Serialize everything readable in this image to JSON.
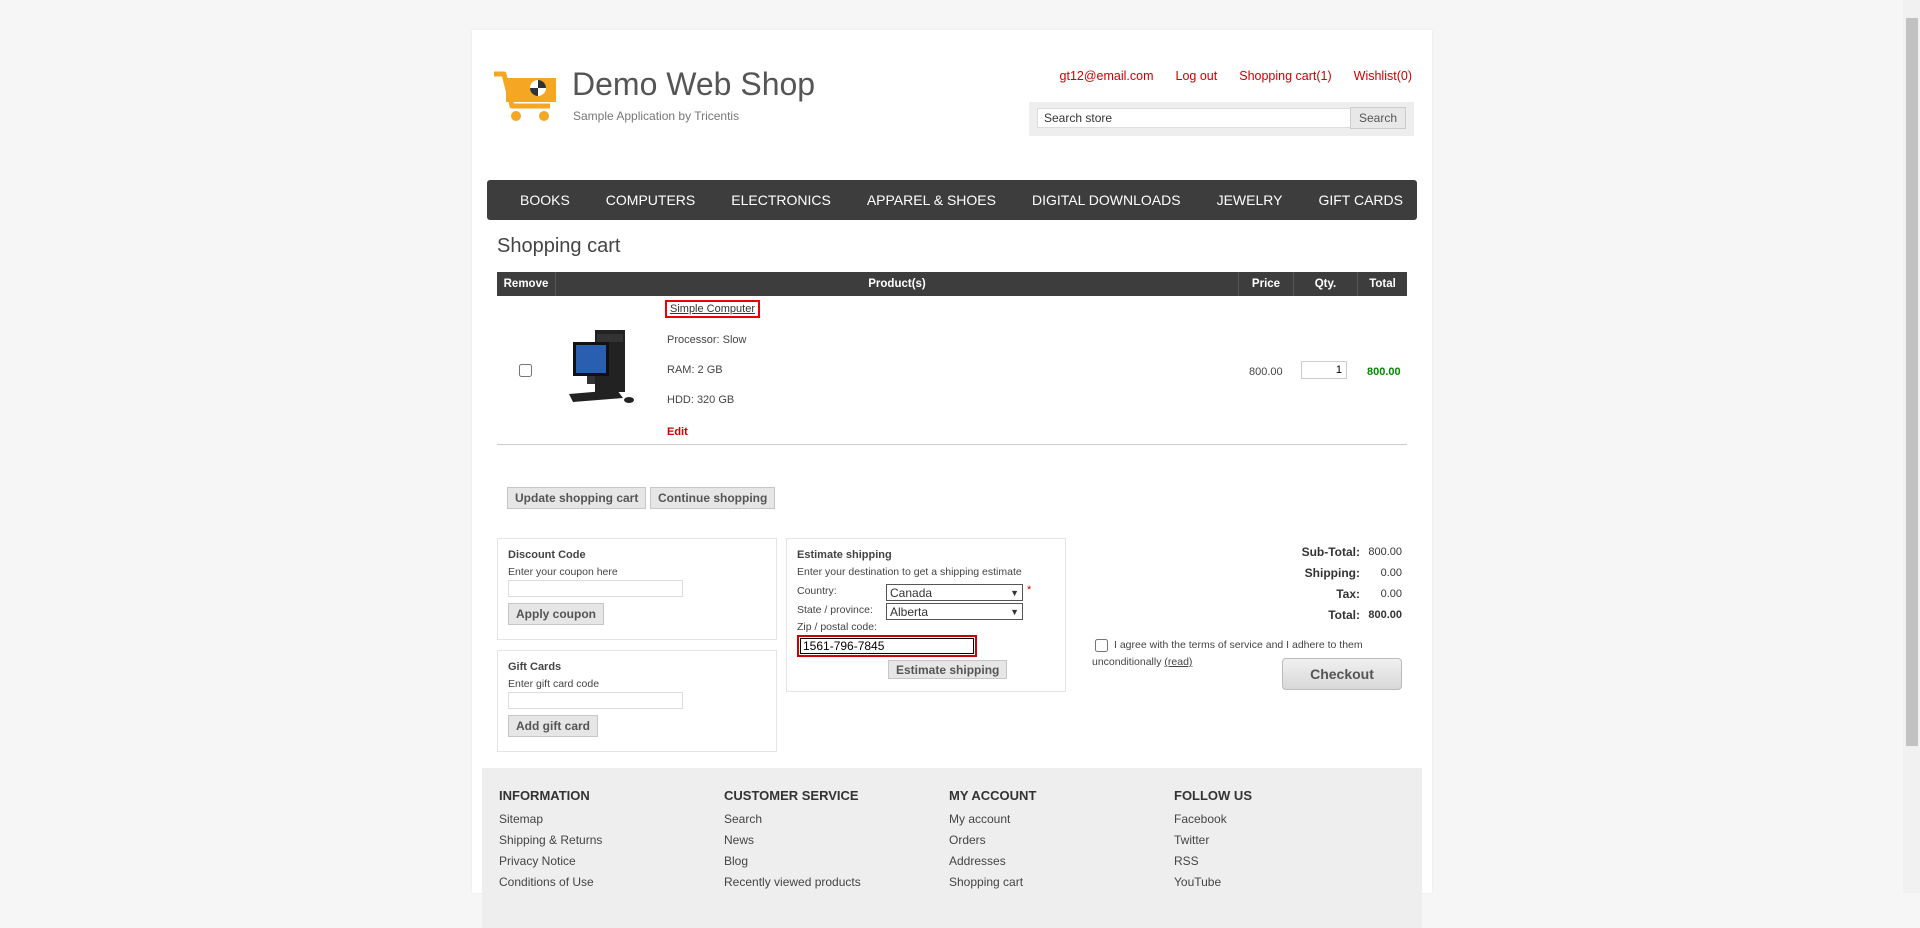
{
  "header": {
    "title": "Demo Web Shop",
    "subtitle": "Sample Application by Tricentis",
    "links": [
      "gt12@email.com",
      "Log out",
      "Shopping cart(1)",
      "Wishlist(0)"
    ],
    "search_placeholder": "Search store",
    "search_button": "Search"
  },
  "nav": [
    "BOOKS",
    "COMPUTERS",
    "ELECTRONICS",
    "APPAREL & SHOES",
    "DIGITAL DOWNLOADS",
    "JEWELRY",
    "GIFT CARDS"
  ],
  "cart": {
    "title": "Shopping cart",
    "columns": [
      "Remove",
      "Product(s)",
      "Price",
      "Qty.",
      "Total"
    ],
    "item": {
      "name": "Simple Computer",
      "attributes": [
        "Processor: Slow",
        "RAM: 2 GB",
        "HDD: 320 GB"
      ],
      "edit": "Edit",
      "price": "800.00",
      "qty": "1",
      "total": "800.00"
    },
    "update_button": "Update shopping cart",
    "continue_button": "Continue shopping"
  },
  "discount": {
    "title": "Discount Code",
    "text": "Enter your coupon here",
    "button": "Apply coupon"
  },
  "giftcards": {
    "title": "Gift Cards",
    "text": "Enter gift card code",
    "button": "Add gift card"
  },
  "shipping": {
    "title": "Estimate shipping",
    "text": "Enter your destination to get a shipping estimate",
    "country_label": "Country:",
    "country_value": "Canada",
    "required": "*",
    "state_label": "State / province:",
    "state_value": "Alberta",
    "zip_label": "Zip / postal code:",
    "zip_value": "1561-796-7845",
    "button": "Estimate shipping"
  },
  "totals": {
    "subtotal_label": "Sub-Total:",
    "subtotal": "800.00",
    "shipping_label": "Shipping:",
    "shipping": "0.00",
    "tax_label": "Tax:",
    "tax": "0.00",
    "total_label": "Total:",
    "total": "800.00",
    "terms_text": "I agree with the terms of service and I adhere to them unconditionally",
    "terms_link": "(read)",
    "checkout_button": "Checkout"
  },
  "footer": {
    "information": {
      "title": "INFORMATION",
      "items": [
        "Sitemap",
        "Shipping & Returns",
        "Privacy Notice",
        "Conditions of Use"
      ]
    },
    "customer_service": {
      "title": "CUSTOMER SERVICE",
      "items": [
        "Search",
        "News",
        "Blog",
        "Recently viewed products"
      ]
    },
    "my_account": {
      "title": "MY ACCOUNT",
      "items": [
        "My account",
        "Orders",
        "Addresses",
        "Shopping cart"
      ]
    },
    "follow_us": {
      "title": "FOLLOW US",
      "items": [
        "Facebook",
        "Twitter",
        "RSS",
        "YouTube"
      ]
    }
  },
  "colors": {
    "accent": "#cc0000",
    "nav_bg": "#3d3d3d",
    "highlight_border": "#ee0000",
    "total_green": "#008800"
  }
}
